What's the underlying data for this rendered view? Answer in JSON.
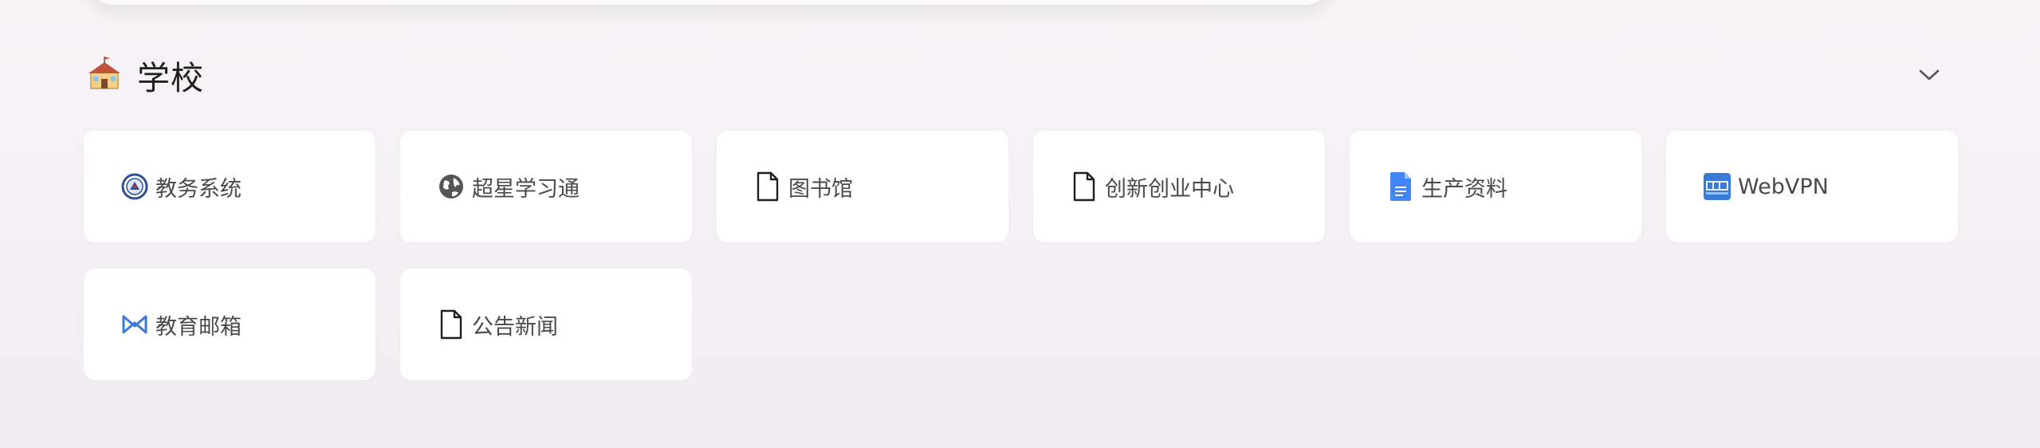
{
  "section": {
    "title": "学校"
  },
  "links": [
    {
      "label": "教务系统",
      "icon": "academic-seal-icon"
    },
    {
      "label": "超星学习通",
      "icon": "globe-icon"
    },
    {
      "label": "图书馆",
      "icon": "document-icon"
    },
    {
      "label": "创新创业中心",
      "icon": "document-icon"
    },
    {
      "label": "生产资料",
      "icon": "google-doc-icon"
    },
    {
      "label": "WebVPN",
      "icon": "webvpn-logo-icon"
    },
    {
      "label": "教育邮箱",
      "icon": "infinity-mail-icon"
    },
    {
      "label": "公告新闻",
      "icon": "document-icon"
    }
  ],
  "colors": {
    "accent_blue": "#4285f4",
    "icon_dark": "#1f1f1f",
    "card_bg": "#ffffff",
    "webvpn_blue": "#3b7bd8"
  }
}
